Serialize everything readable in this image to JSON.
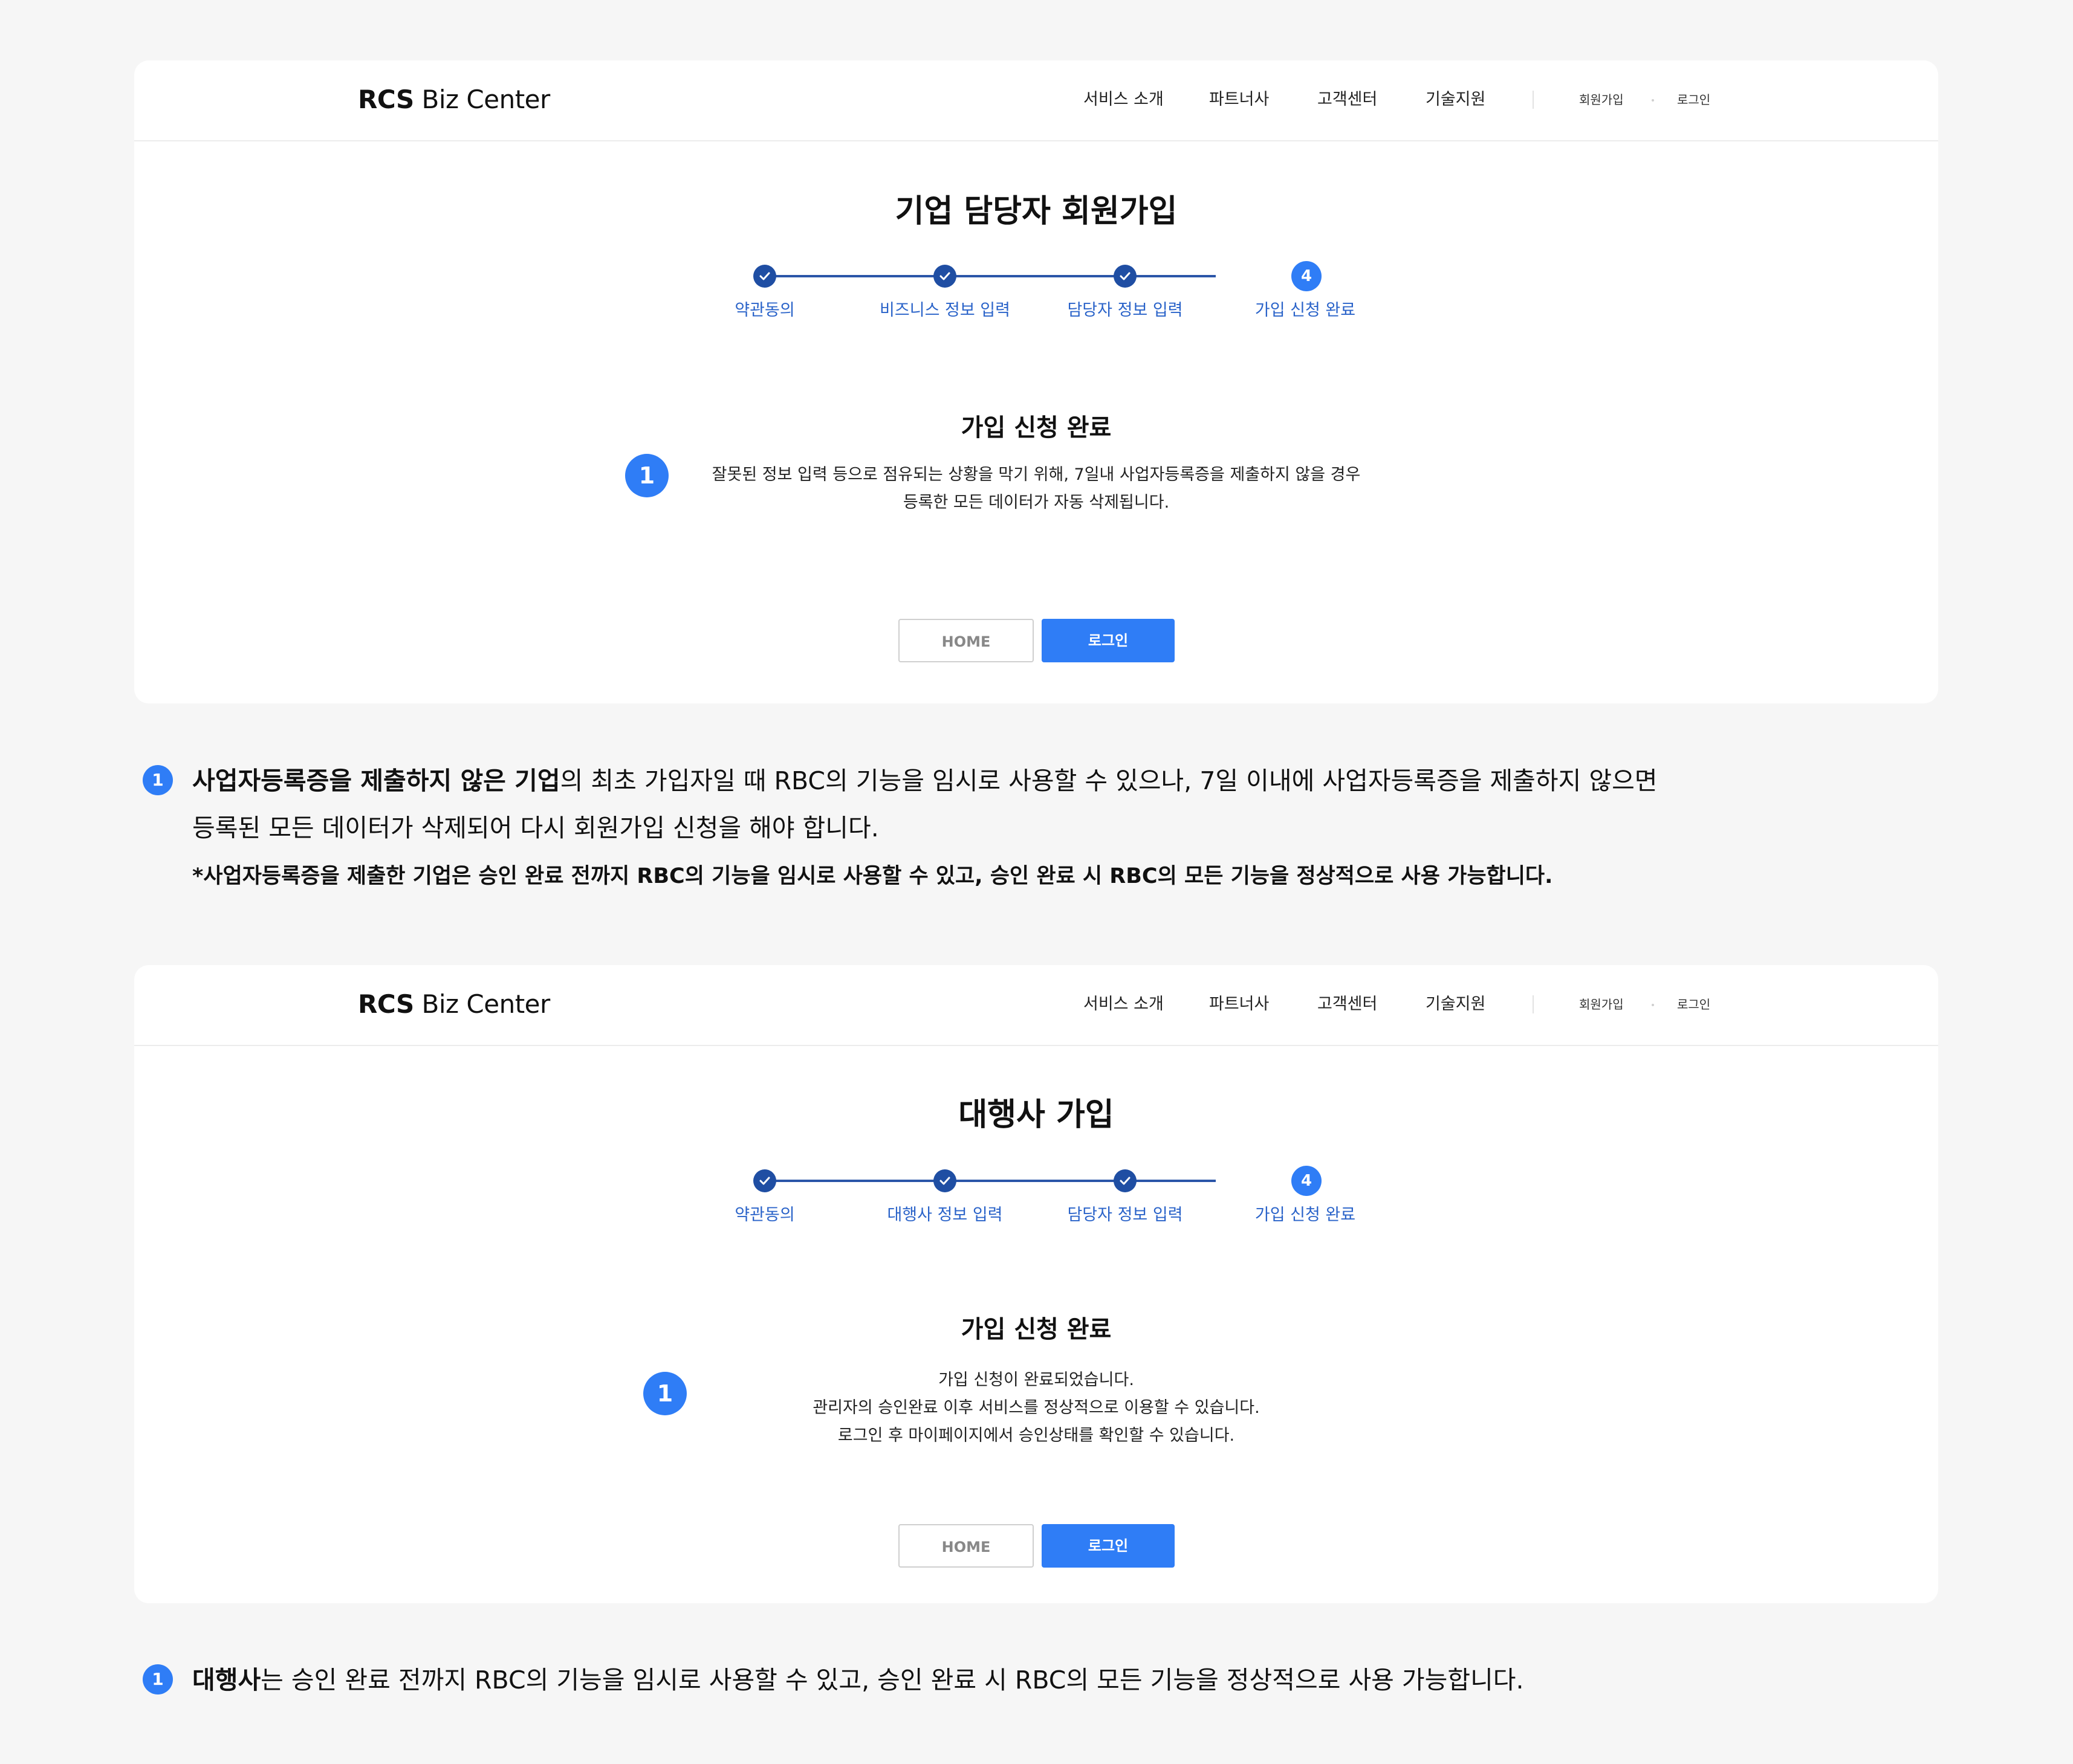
{
  "gnb": {
    "logo_bold": "RCS",
    "logo_rest": " Biz Center",
    "nav": [
      "서비스 소개",
      "파트너사",
      "고객센터",
      "기술지원"
    ],
    "signup": "회원가입",
    "login": "로그인"
  },
  "card1": {
    "title": "기업 담당자 회원가입",
    "steps": [
      "약관동의",
      "비즈니스 정보 입력",
      "담당자 정보 입력",
      "가입 신청 완료"
    ],
    "current_step_number": "4",
    "subtitle": "가입 신청 완료",
    "badge": "1",
    "desc_lines": [
      "잘못된 정보 입력 등으로 점유되는 상황을 막기 위해, 7일내 사업자등록증을 제출하지 않을 경우",
      "등록한 모든 데이터가 자동 삭제됩니다."
    ],
    "home_button": "HOME",
    "login_button": "로그인"
  },
  "note1": {
    "badge": "1",
    "line1_bold": "사업자등록증을 제출하지 않은 기업",
    "line1_rest": "의 최초 가입자일 때 RBC의 기능을 임시로 사용할 수 있으나, 7일 이내에 사업자등록증을 제출하지 않으면",
    "line2": "등록된 모든 데이터가 삭제되어 다시 회원가입 신청을 해야 합니다.",
    "line3": "*사업자등록증을 제출한 기업은 승인 완료 전까지 RBC의 기능을 임시로 사용할 수 있고, 승인 완료 시 RBC의 모든 기능을 정상적으로 사용 가능합니다."
  },
  "card2": {
    "title": "대행사 가입",
    "steps": [
      "약관동의",
      "대행사 정보 입력",
      "담당자 정보 입력",
      "가입 신청 완료"
    ],
    "current_step_number": "4",
    "subtitle": "가입 신청 완료",
    "badge": "1",
    "desc_lines": [
      "가입 신청이 완료되었습니다.",
      "관리자의 승인완료 이후 서비스를 정상적으로 이용할 수 있습니다.",
      "로그인 후 마이페이지에서 승인상태를 확인할 수 있습니다."
    ],
    "home_button": "HOME",
    "login_button": "로그인"
  },
  "note2": {
    "badge": "1",
    "line1_bold": "대행사",
    "line1_rest": "는 승인 완료 전까지 RBC의 기능을 임시로 사용할 수 있고, 승인 완료 시 RBC의 모든 기능을 정상적으로 사용 가능합니다."
  },
  "colors": {
    "accent": "#2f7df6",
    "step_done": "#1f4ea3",
    "step_label": "#2a63c9",
    "background": "#f6f6f6"
  },
  "icons": {
    "completed_step": "check-icon",
    "numbered_badge": "number-badge-icon"
  }
}
